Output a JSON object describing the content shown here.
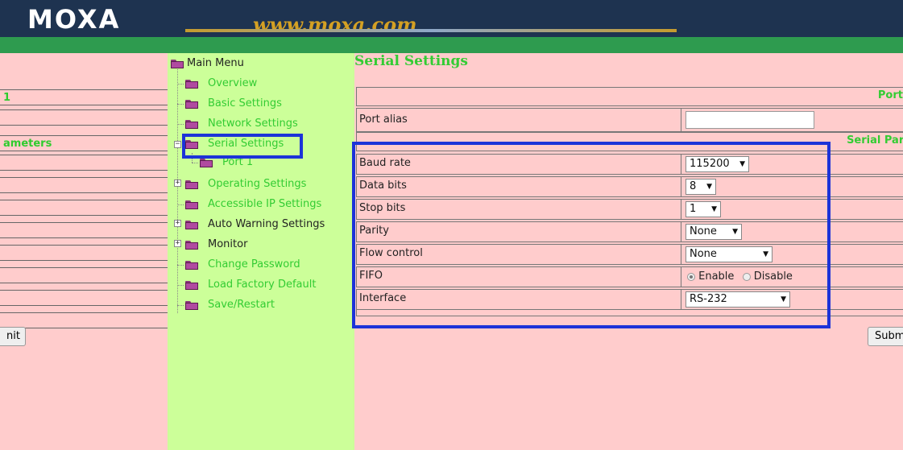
{
  "header": {
    "logo": "MOXA",
    "url": "www.moxa.com"
  },
  "left_pane": {
    "rows": [
      "1",
      "ameters"
    ],
    "button_label": "nit"
  },
  "menu": {
    "root": "Main Menu",
    "items": [
      {
        "label": "Overview"
      },
      {
        "label": "Basic Settings"
      },
      {
        "label": "Network Settings"
      },
      {
        "label": "Serial Settings"
      },
      {
        "label": "Port 1"
      },
      {
        "label": "Operating Settings"
      },
      {
        "label": "Accessible IP Settings"
      },
      {
        "label": "Auto Warning Settings"
      },
      {
        "label": "Monitor"
      },
      {
        "label": "Change Password"
      },
      {
        "label": "Load Factory Default"
      },
      {
        "label": "Save/Restart"
      }
    ]
  },
  "main": {
    "title": "Serial Settings",
    "port_header": "Port",
    "port_alias_label": "Port alias",
    "port_alias_value": "",
    "serial_params_header": "Serial Para",
    "fields": {
      "baud_rate": {
        "label": "Baud rate",
        "value": "115200"
      },
      "data_bits": {
        "label": "Data bits",
        "value": "8"
      },
      "stop_bits": {
        "label": "Stop bits",
        "value": "1"
      },
      "parity": {
        "label": "Parity",
        "value": "None"
      },
      "flow_control": {
        "label": "Flow control",
        "value": "None"
      },
      "fifo": {
        "label": "FIFO",
        "enable": "Enable",
        "disable": "Disable",
        "selected": "Enable"
      },
      "interface": {
        "label": "Interface",
        "value": "RS-232"
      }
    },
    "submit_label": "Subm"
  },
  "colors": {
    "header_bg": "#1e3350",
    "green_bar": "#2e9b4f",
    "menu_bg": "#ccff99",
    "content_bg": "#ffcccc",
    "accent_text": "#33cc33",
    "highlight": "#1c33d8"
  }
}
